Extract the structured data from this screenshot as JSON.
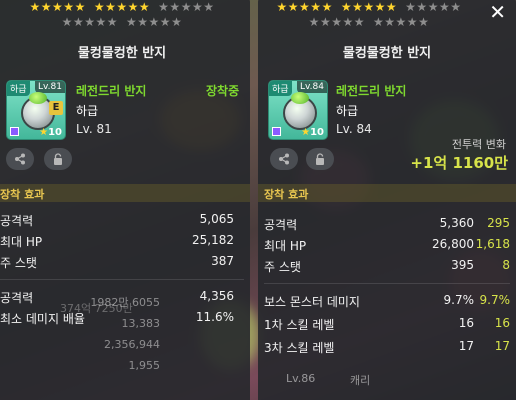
{
  "background": {
    "list_values": [
      "1982만 6055",
      "13,383",
      "2,356,944",
      "1,955"
    ],
    "overlay_text": "374억 7250만",
    "bottom_label": "Lv.86",
    "bottom_name": "캐리"
  },
  "left": {
    "stars_top": [
      "gold",
      "gold",
      "gold",
      "gold",
      "gold",
      "gap",
      "gold",
      "gold",
      "gold",
      "gold",
      "gold",
      "gap",
      "gray",
      "gray",
      "gray",
      "gray",
      "gray"
    ],
    "stars_bottom": [
      "gray",
      "gray",
      "gray",
      "gray",
      "gray",
      "gap",
      "gray",
      "gray",
      "gray",
      "gray",
      "gray"
    ],
    "title": "물컹물컹한 반지",
    "icon": {
      "grade_tag": "하급",
      "lv_tag": "Lv.81",
      "equip_badge": "E",
      "star_count": "10",
      "star_glyph": "★"
    },
    "item_name": "레전드리 반지",
    "equipped_label": "장착중",
    "grade": "하급",
    "level": "Lv. 81",
    "share_icon": "share-icon",
    "lock_icon": "lock-icon",
    "section_title": "장착 효과",
    "stats": [
      {
        "label": "공격력",
        "value": "5,065"
      },
      {
        "label": "최대 HP",
        "value": "25,182"
      },
      {
        "label": "주 스탯",
        "value": "387"
      }
    ],
    "stats2": [
      {
        "label": "공격력",
        "value": "4,356"
      },
      {
        "label": "최소 데미지 배율",
        "value": "11.6%"
      }
    ]
  },
  "right": {
    "stars_top": [
      "gold",
      "gold",
      "gold",
      "gold",
      "gold",
      "gap",
      "gold",
      "gold",
      "gold",
      "gold",
      "gold",
      "gap",
      "gray",
      "gray",
      "gray",
      "gray",
      "gray"
    ],
    "stars_bottom": [
      "gray",
      "gray",
      "gray",
      "gray",
      "gray",
      "gap",
      "gray",
      "gray",
      "gray",
      "gray",
      "gray"
    ],
    "title": "물컹물컹한 반지",
    "close_label": "✕",
    "icon": {
      "grade_tag": "하급",
      "lv_tag": "Lv.84",
      "star_count": "10",
      "star_glyph": "★"
    },
    "item_name": "레전드리 반지",
    "grade": "하급",
    "level": "Lv. 84",
    "combat_label": "전투력 변화",
    "combat_value": "+1억 1160만",
    "share_icon": "share-icon",
    "lock_icon": "lock-icon",
    "section_title": "장착 효과",
    "stats": [
      {
        "label": "공격력",
        "value": "5,360",
        "delta": "295"
      },
      {
        "label": "최대 HP",
        "value": "26,800",
        "delta": "1,618"
      },
      {
        "label": "주 스탯",
        "value": "395",
        "delta": "8"
      }
    ],
    "stats2": [
      {
        "label": "보스 몬스터 데미지",
        "value": "9.7%",
        "delta": "9.7%"
      },
      {
        "label": "1차 스킬 레벨",
        "value": "16",
        "delta": "16"
      },
      {
        "label": "3차 스킬 레벨",
        "value": "17",
        "delta": "17"
      }
    ]
  },
  "colors": {
    "gold_star": "#ffd52e",
    "gray_star": "#8e8e8e",
    "legendary_green": "#7fd92f",
    "section_yellow": "#e8c650",
    "delta_yellow": "#d7e34a"
  }
}
